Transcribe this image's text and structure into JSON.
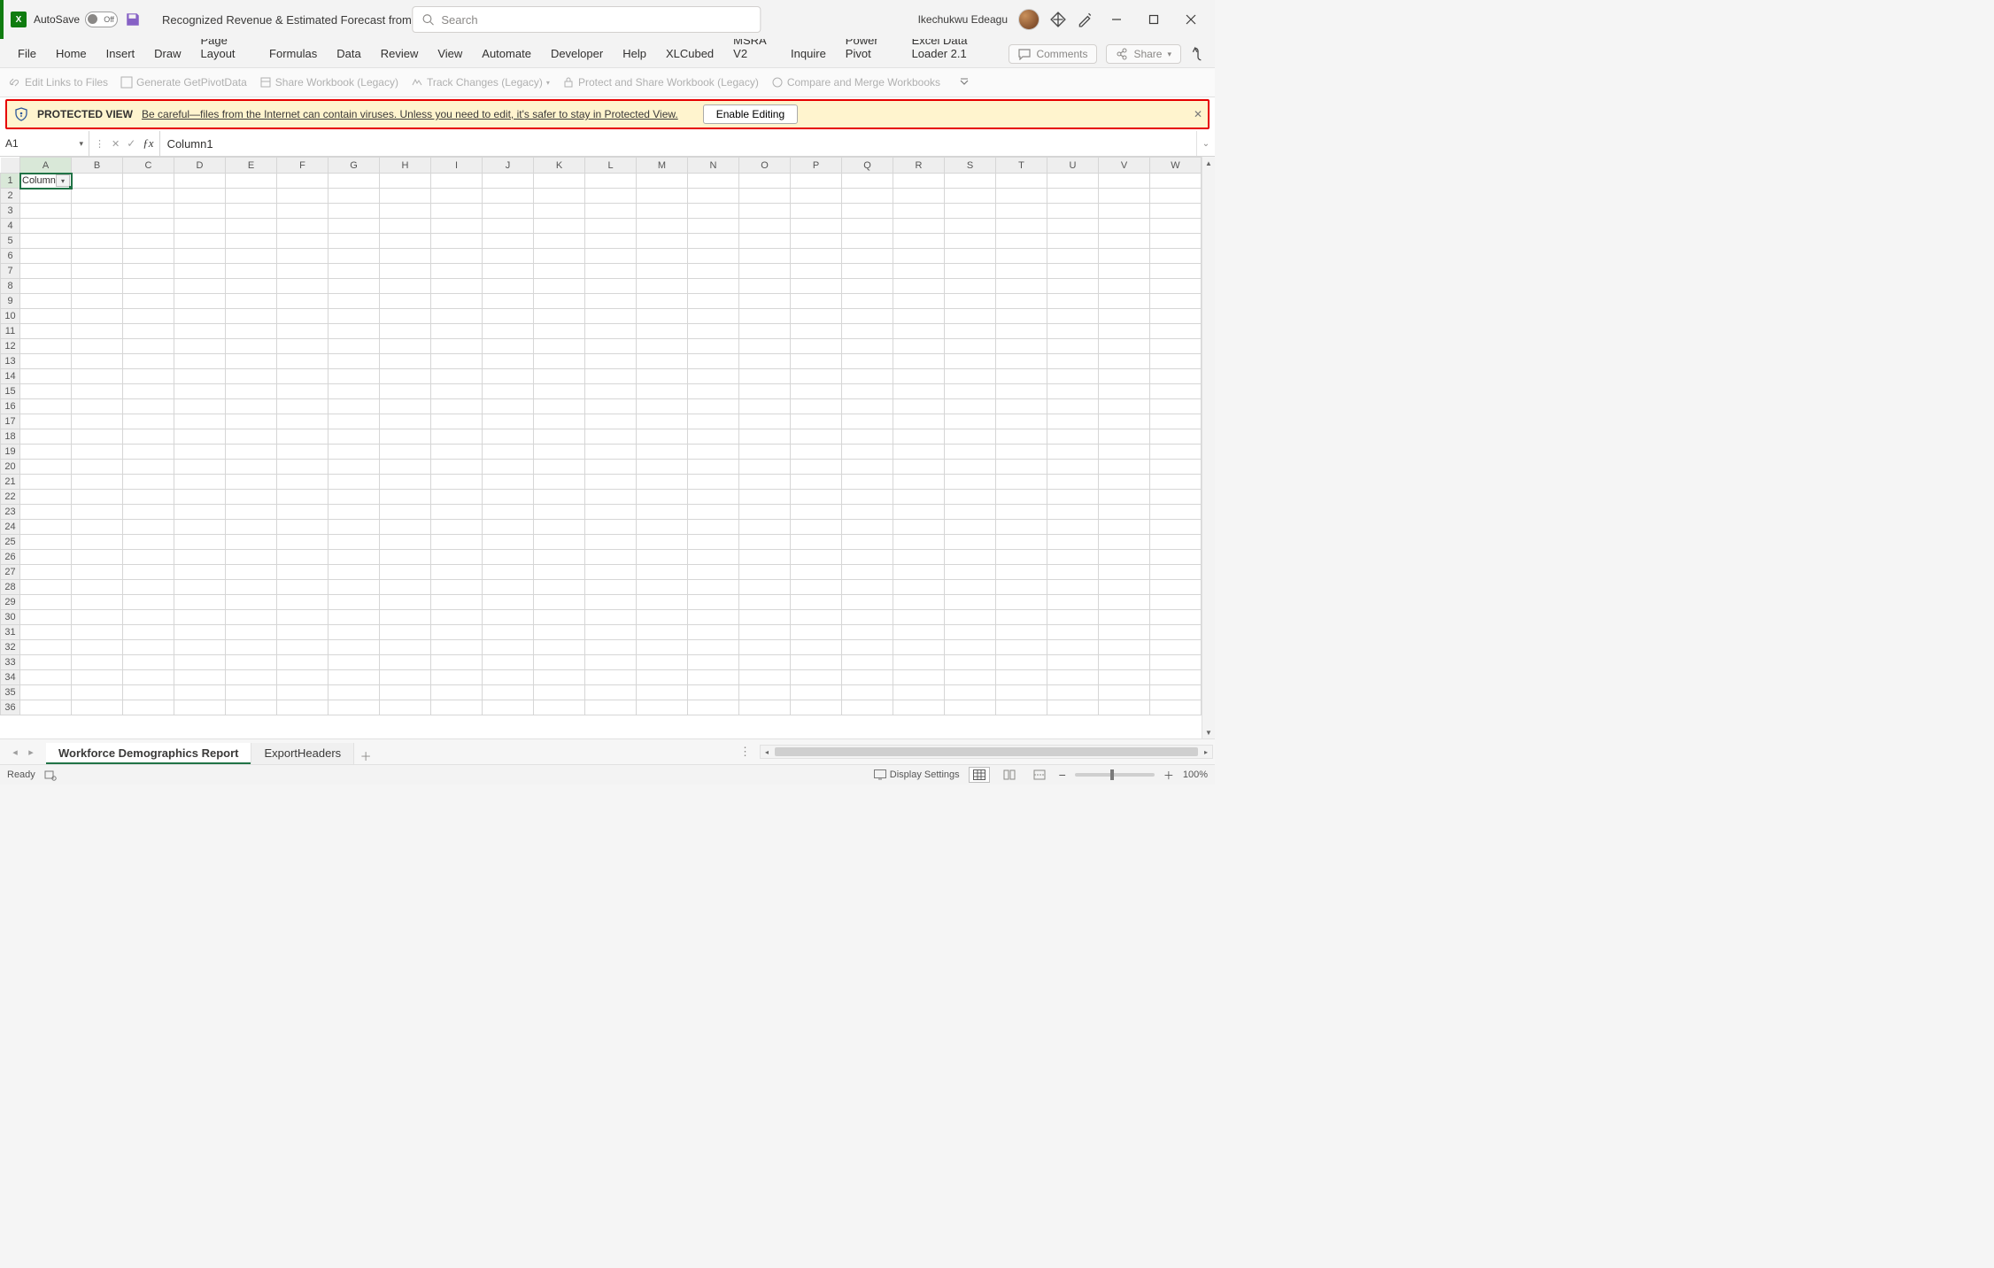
{
  "title_bar": {
    "autosave_label": "AutoSave",
    "autosave_state": "Off",
    "doc_title": "Recognized Revenue & Estimated Forecast from SalesForce & Backlog  -  Protected...",
    "search_placeholder": "Search",
    "user_name": "Ikechukwu Edeagu"
  },
  "ribbon": {
    "tabs": [
      "File",
      "Home",
      "Insert",
      "Draw",
      "Page Layout",
      "Formulas",
      "Data",
      "Review",
      "View",
      "Automate",
      "Developer",
      "Help",
      "XLCubed",
      "MSRA V2",
      "Inquire",
      "Power Pivot",
      "Excel Data Loader 2.1"
    ],
    "comments_label": "Comments",
    "share_label": "Share"
  },
  "disabled_cmds": {
    "edit_links": "Edit Links to Files",
    "gen_pivot": "Generate GetPivotData",
    "share_legacy": "Share Workbook (Legacy)",
    "track_changes": "Track Changes (Legacy)",
    "protect_share": "Protect and Share Workbook (Legacy)",
    "compare_merge": "Compare and Merge Workbooks"
  },
  "protected_view": {
    "title": "PROTECTED VIEW",
    "message": "Be careful—files from the Internet can contain viruses. Unless you need to edit, it's safer to stay in Protected View.",
    "button": "Enable Editing"
  },
  "name_box": {
    "value": "A1"
  },
  "formula_bar": {
    "value": "Column1"
  },
  "grid": {
    "columns": [
      "A",
      "B",
      "C",
      "D",
      "E",
      "F",
      "G",
      "H",
      "I",
      "J",
      "K",
      "L",
      "M",
      "N",
      "O",
      "P",
      "Q",
      "R",
      "S",
      "T",
      "U",
      "V",
      "W"
    ],
    "row_count": 36,
    "a1_value": "Column"
  },
  "sheets": {
    "active": "Workforce Demographics Report",
    "others": [
      "ExportHeaders"
    ]
  },
  "status": {
    "ready": "Ready",
    "display_settings": "Display Settings",
    "zoom": "100%"
  }
}
